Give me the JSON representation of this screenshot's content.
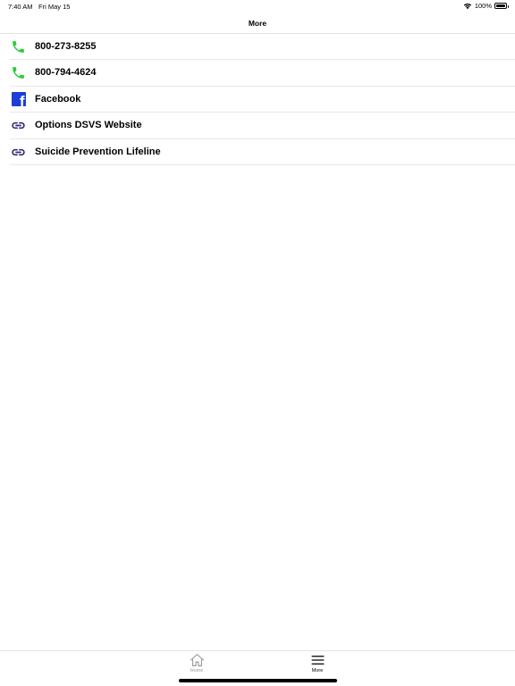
{
  "status_bar": {
    "time": "7:40 AM",
    "date": "Fri May 15",
    "battery": "100%",
    "battery_level": 1.0
  },
  "nav": {
    "title": "More"
  },
  "list": {
    "items": [
      {
        "label": "800-273-8255",
        "icon": "phone-icon"
      },
      {
        "label": "800-794-4624",
        "icon": "phone-icon"
      },
      {
        "label": "Facebook",
        "icon": "facebook-icon"
      },
      {
        "label": "Options DSVS Website",
        "icon": "link-icon"
      },
      {
        "label": "Suicide Prevention Lifeline",
        "icon": "link-icon"
      }
    ]
  },
  "tab_bar": {
    "tabs": [
      {
        "label": "Home",
        "icon": "home-icon",
        "selected": false
      },
      {
        "label": "More",
        "icon": "menu-icon",
        "selected": true
      }
    ]
  },
  "colors": {
    "phone": "#2ecc40",
    "facebook": "#1a3fd6",
    "link": "#3a2a7a",
    "tab_inactive": "#9a9a9a",
    "tab_active": "#000000"
  }
}
